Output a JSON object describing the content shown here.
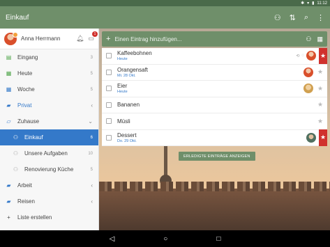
{
  "status_bar": {
    "time": "11:12",
    "icons": [
      "bluetooth-icon",
      "wifi-icon",
      "battery-icon"
    ]
  },
  "header": {
    "title": "Einkauf",
    "icons": [
      "add-member-icon",
      "sort-icon",
      "search-icon",
      "more-icon"
    ]
  },
  "user": {
    "name": "Anna Herrmann",
    "notification_count": "1"
  },
  "sidebar": {
    "items": [
      {
        "label": "Eingang",
        "count": "3",
        "icon": "inbox-icon",
        "type": "list"
      },
      {
        "label": "Heute",
        "count": "5",
        "icon": "today-icon",
        "type": "list"
      },
      {
        "label": "Woche",
        "count": "5",
        "icon": "week-icon",
        "type": "list"
      },
      {
        "label": "Privat",
        "count": "",
        "icon": "folder-icon",
        "type": "folder",
        "expanded": false
      },
      {
        "label": "Zuhause",
        "count": "",
        "icon": "folder-icon",
        "type": "folder",
        "expanded": true
      },
      {
        "label": "Einkauf",
        "count": "6",
        "icon": "shared-list-icon",
        "type": "sub",
        "active": true
      },
      {
        "label": "Unsere Aufgaben",
        "count": "10",
        "icon": "shared-list-icon",
        "type": "sub"
      },
      {
        "label": "Renovierung Küche",
        "count": "5",
        "icon": "shared-list-icon",
        "type": "sub"
      },
      {
        "label": "Arbeit",
        "count": "",
        "icon": "folder-icon",
        "type": "folder",
        "expanded": false
      },
      {
        "label": "Reisen",
        "count": "",
        "icon": "folder-icon",
        "type": "folder",
        "expanded": false
      }
    ],
    "create_label": "Liste erstellen"
  },
  "add_bar": {
    "placeholder": "Einen Eintrag hinzufügen..."
  },
  "tasks": [
    {
      "name": "Kaffeebohnen",
      "due": "Heute",
      "starred": true,
      "assignee": "a1"
    },
    {
      "name": "Orangensaft",
      "due": "Mi. 28 Okt.",
      "starred": false,
      "assignee": "a1"
    },
    {
      "name": "Eier",
      "due": "Heute",
      "starred": false,
      "assignee": "a2"
    },
    {
      "name": "Bananen",
      "due": "",
      "starred": false,
      "assignee": ""
    },
    {
      "name": "Müsli",
      "due": "",
      "starred": false,
      "assignee": ""
    },
    {
      "name": "Dessert",
      "due": "Do. 29 Okt.",
      "starred": true,
      "assignee": "a3"
    }
  ],
  "show_completed_label": "ERLEDIGTE EINTRÄGE ANZEIGEN",
  "colors": {
    "header": "#6f8f6a",
    "accent_blue": "#3479c9",
    "star_red": "#d0312d"
  }
}
